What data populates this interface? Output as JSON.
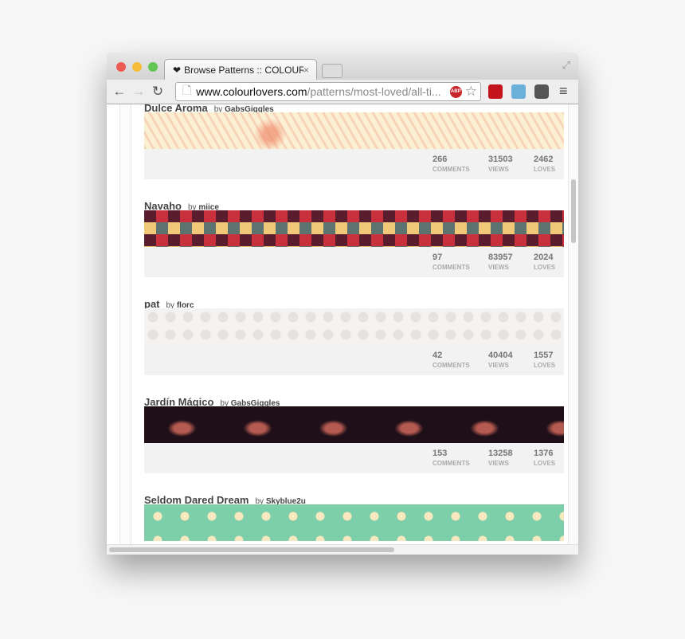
{
  "browser": {
    "tab_title": "Browse Patterns :: COLOURlovers",
    "tab_close": "×",
    "url_domain": "www.colourlovers.com",
    "url_path": "/patterns/most-loved/all-ti...",
    "abp_label": "ABP",
    "back": "←",
    "forward": "→",
    "reload": "↻",
    "star": "☆",
    "menu": "≡"
  },
  "labels": {
    "by": "by",
    "comments": "COMMENTS",
    "views": "VIEWS",
    "loves": "LOVES"
  },
  "patterns": [
    {
      "name": "Dulce Aroma",
      "author": "GabsGiggles",
      "comments": "266",
      "views": "31503",
      "loves": "2462"
    },
    {
      "name": "Navaho",
      "author": "miice",
      "comments": "97",
      "views": "83957",
      "loves": "2024"
    },
    {
      "name": "pat",
      "author": "florc",
      "comments": "42",
      "views": "40404",
      "loves": "1557"
    },
    {
      "name": "Jardín Mágico",
      "author": "GabsGiggles",
      "comments": "153",
      "views": "13258",
      "loves": "1376"
    },
    {
      "name": "Seldom Dared Dream",
      "author": "Skyblue2u",
      "comments": "",
      "views": "",
      "loves": ""
    }
  ],
  "colors": {
    "close": "#ee5b52",
    "minimize": "#f5bd3a",
    "zoom": "#62c654"
  }
}
